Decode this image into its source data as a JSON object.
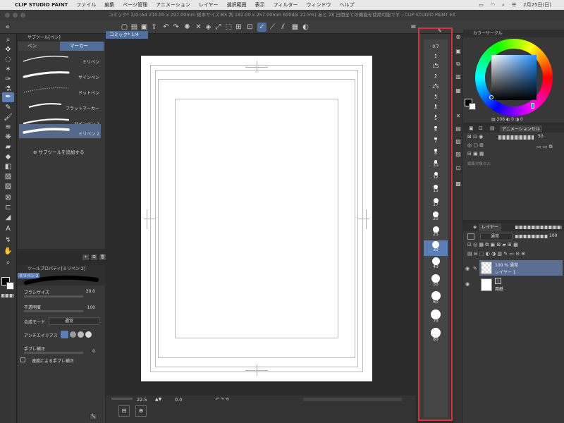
{
  "menubar": {
    "app_name": "CLIP STUDIO PAINT",
    "items": [
      "ファイル",
      "編集",
      "ページ管理",
      "アニメーション",
      "レイヤー",
      "選択範囲",
      "表示",
      "フィルター",
      "ウィンドウ",
      "ヘルプ"
    ],
    "date": "2月25日(日)"
  },
  "titlebar": {
    "title": "コミック* 1/4 (A4 210.00 x 297.00mm 仮本サイズ:B5 判 182.00 x 257.00mm 600dpi 22.5%) あと 28 日間全ての機能を使用可能です - CLIP STUDIO PAINT EX"
  },
  "document_tab": {
    "label": "コミック* 1/4"
  },
  "subtool_panel": {
    "header": "サブツール[ペン]",
    "tabs": [
      "ペン",
      "マーカー"
    ],
    "active_tab_index": 1,
    "brushes": [
      {
        "label": "ミリペン"
      },
      {
        "label": "サインペン"
      },
      {
        "label": "ドットペン"
      },
      {
        "label": "フラットマーカー"
      },
      {
        "label": "サインペン 2"
      },
      {
        "label": "ミリペン 2"
      }
    ],
    "add_subtool": "サブツールを追加する"
  },
  "tool_property": {
    "header": "ツールプロパティ[ミリペン 2]",
    "preview_label": "ミリペン 2",
    "brush_size_label": "ブラシサイズ",
    "brush_size_value": "30.0",
    "opacity_label": "不透明度",
    "opacity_value": "100",
    "blend_label": "合成モード",
    "blend_value": "通常",
    "antialias_label": "アンチエイリアス",
    "stabilization_label": "手ブレ補正",
    "stabilization_value": "0",
    "speed_stabilization_label": "速度による手ブレ補正"
  },
  "canvas_status": {
    "zoom": "22.5",
    "rotation": "0.0"
  },
  "brush_sizes": [
    "0.7",
    "1",
    "1.5",
    "2",
    "2.5",
    "3",
    "4",
    "5",
    "6",
    "7",
    "8",
    "10",
    "12",
    "15",
    "17",
    "20",
    "25",
    "30",
    "40",
    "50",
    "60",
    "70",
    "80"
  ],
  "active_brush_size": "30",
  "color_panel": {
    "header": "カラーサークル",
    "values": [
      "208",
      "0",
      "0"
    ]
  },
  "animation_panel": {
    "header": "アニメーションセル",
    "opacity": "50",
    "note": "編集対象セル"
  },
  "layer_panel": {
    "header": "レイヤー",
    "blend_mode": "通常",
    "opacity": "100",
    "layers": [
      {
        "line1": "100 % 通常",
        "line2": "レイヤー 1",
        "active": true
      },
      {
        "line1": "",
        "line2": "用紙",
        "active": false
      }
    ]
  },
  "colors": {
    "accent": "#5a7fb8",
    "highlight": "#e0323d",
    "paper": "#ffffff"
  }
}
